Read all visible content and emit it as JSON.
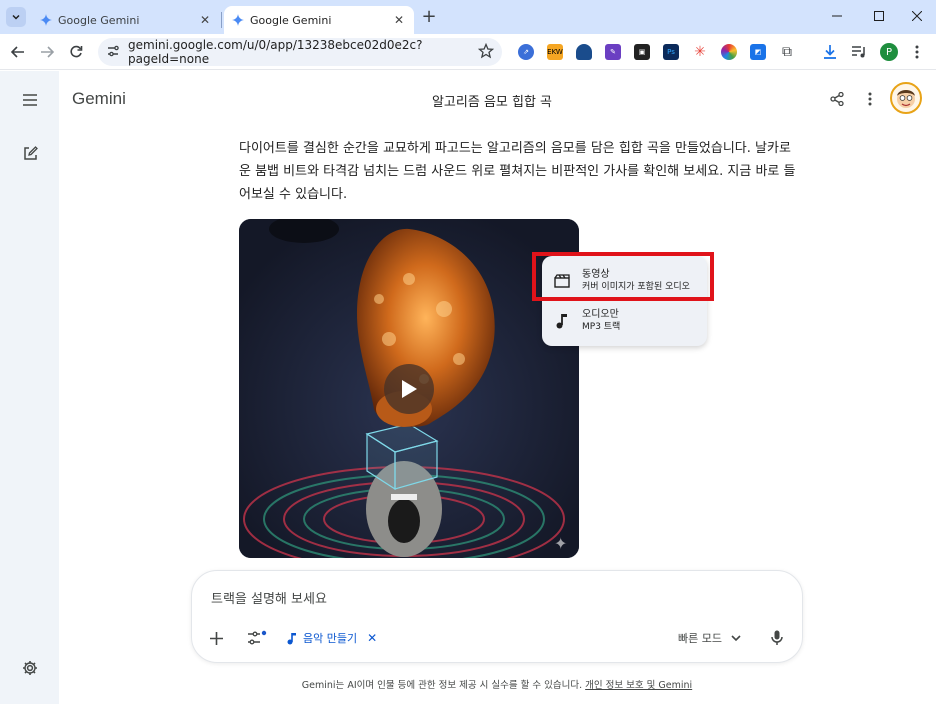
{
  "browser": {
    "tabs": [
      {
        "label": "Google Gemini",
        "active": false
      },
      {
        "label": "Google Gemini",
        "active": true
      }
    ],
    "url": "gemini.google.com/u/0/app/13238ebce02d0e2c?pageId=none",
    "profile_initial": "P",
    "extensions": [
      "circle-arrow-icon",
      "ekw-icon",
      "shield-icon",
      "pen-icon",
      "puzzle-pink-icon",
      "ps-icon",
      "asterisk-icon",
      "color-wheel-icon",
      "image-icon",
      "puzzle-icon"
    ],
    "ext_ekw_label": "EKW",
    "ext_ps_label": "Ps"
  },
  "app": {
    "brand": "Gemini",
    "conversation_title": "알고리즘 음모 힙합 곡"
  },
  "response": {
    "text": "다이어트를 결심한 순간을 교묘하게 파고드는 알고리즘의 음모를 담은 힙합 곡을 만들었습니다. 날카로운 붐뱁 비트와 타격감 넘치는 드럼 사운드 위로 펼쳐지는 비판적인 가사를 확인해 보세요. 지금 바로 들어보실 수 있습니다."
  },
  "download_menu": {
    "items": [
      {
        "title": "동영상",
        "subtitle": "커버 이미지가 포함된 오디오",
        "icon": "clapperboard-icon"
      },
      {
        "title": "오디오만",
        "subtitle": "MP3 트랙",
        "icon": "music-note-icon"
      }
    ]
  },
  "input": {
    "placeholder": "트랙을 설명해 보세요",
    "chip_label": "음악 만들기",
    "mode_label": "빠른 모드"
  },
  "footer": {
    "disclaimer": "Gemini는 AI이며 인물 등에 관한 정보 제공 시 실수를 할 수 있습니다.",
    "link": "개인 정보 보호 및 Gemini"
  },
  "colors": {
    "accent": "#0b57d0",
    "highlight": "#e0131a",
    "tabstrip": "#d3e3fd",
    "sidebar": "#f0f4f9"
  }
}
